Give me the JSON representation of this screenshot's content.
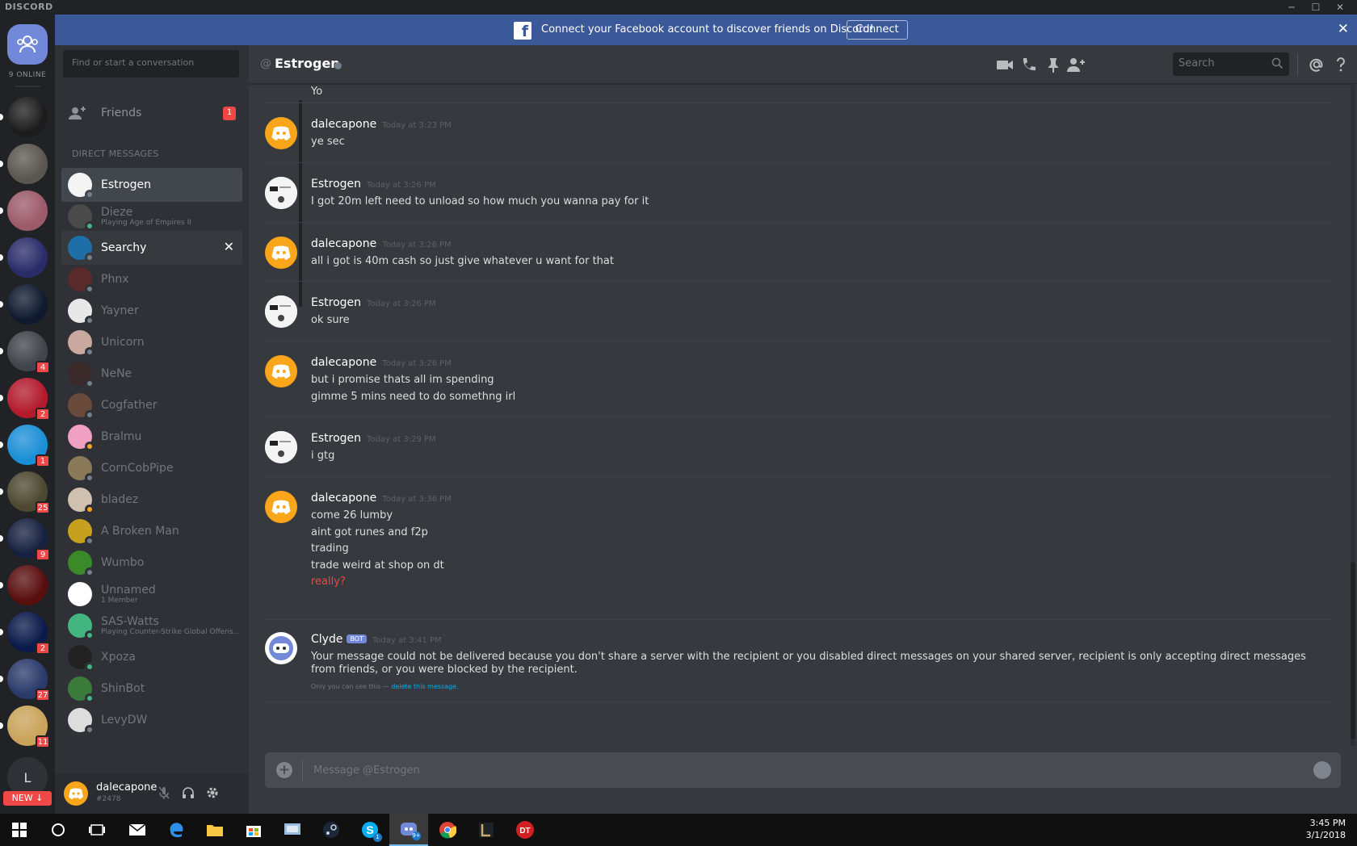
{
  "window": {
    "brand": "DISCORD",
    "controls": [
      "─",
      "☐",
      "✕"
    ]
  },
  "guilds": {
    "online_label": "9 ONLINE",
    "items": [
      {
        "color": "#1c1c1c",
        "badge": "",
        "pill": true
      },
      {
        "color": "#5a5650",
        "badge": "",
        "pill": true
      },
      {
        "color": "#9c5a6a",
        "badge": "",
        "pill": true
      },
      {
        "color": "#2a2c6a",
        "badge": "",
        "pill": true
      },
      {
        "color": "#0f1a2e",
        "badge": "",
        "pill": true
      },
      {
        "color": "#40444b",
        "badge": "4",
        "pill": true
      },
      {
        "color": "#b31b2d",
        "badge": "2",
        "pill": true
      },
      {
        "color": "#1b8fd6",
        "badge": "1",
        "pill": true
      },
      {
        "color": "#4d4830",
        "badge": "25",
        "pill": true
      },
      {
        "color": "#162040",
        "badge": "9",
        "pill": true
      },
      {
        "color": "#5a0f0f",
        "badge": "",
        "pill": true
      },
      {
        "color": "#0a1a4a",
        "badge": "2",
        "pill": true
      },
      {
        "color": "#2a3a6a",
        "badge": "27",
        "pill": true
      },
      {
        "color": "#c9a35a",
        "badge": "11",
        "pill": true
      }
    ],
    "letter_guild": "L",
    "new_label": "NEW ↓"
  },
  "sidebar": {
    "search_placeholder": "Find or start a conversation",
    "friends_label": "Friends",
    "friends_badge": "1",
    "dm_header": "DIRECT MESSAGES",
    "dms": [
      {
        "name": "Estrogen",
        "sub": "",
        "status": "#747f8d",
        "avatar": "#f4f4f4"
      },
      {
        "name": "Dieze",
        "sub": "Playing Age of Empires II",
        "status": "#43b581",
        "avatar": "#4a4a4a"
      },
      {
        "name": "Searchy",
        "sub": "",
        "status": "#747f8d",
        "avatar": "#1e6fa8"
      },
      {
        "name": "Phnx",
        "sub": "",
        "status": "#747f8d",
        "avatar": "#5a2a2a"
      },
      {
        "name": "Yayner",
        "sub": "",
        "status": "#747f8d",
        "avatar": "#e8e8e8"
      },
      {
        "name": "Unicorn",
        "sub": "",
        "status": "#747f8d",
        "avatar": "#c9a8a0"
      },
      {
        "name": "NeNe",
        "sub": "",
        "status": "#747f8d",
        "avatar": "#3a2a2a"
      },
      {
        "name": "Cogfather",
        "sub": "",
        "status": "#747f8d",
        "avatar": "#6a4a3a"
      },
      {
        "name": "Bralmu",
        "sub": "",
        "status": "#faa61a",
        "avatar": "#f0a0c0"
      },
      {
        "name": "CornCobPipe",
        "sub": "",
        "status": "#747f8d",
        "avatar": "#8a7a5a"
      },
      {
        "name": "bladez",
        "sub": "",
        "status": "#faa61a",
        "avatar": "#d0c0b0"
      },
      {
        "name": "A Broken Man",
        "sub": "",
        "status": "#747f8d",
        "avatar": "#c8a020"
      },
      {
        "name": "Wumbo",
        "sub": "",
        "status": "#747f8d",
        "avatar": "#3a8a2a"
      },
      {
        "name": "Unnamed",
        "sub": "1 Member",
        "status": "",
        "avatar": "#ffffff"
      },
      {
        "name": "SAS-Watts",
        "sub": "Playing Counter-Strike Global Offens...",
        "status": "#43b581",
        "avatar": "#43b581"
      },
      {
        "name": "Xpoza",
        "sub": "",
        "status": "#43b581",
        "avatar": "#222222"
      },
      {
        "name": "ShinBot",
        "sub": "",
        "status": "#43b581",
        "avatar": "#3a7a3a"
      },
      {
        "name": "LevyDW",
        "sub": "",
        "status": "#747f8d",
        "avatar": "#dddddd"
      }
    ]
  },
  "user": {
    "name": "dalecapone",
    "tag": "#2478"
  },
  "banner": {
    "text": "Connect your Facebook account to discover friends on Discord!",
    "button": "Connect"
  },
  "header": {
    "at": "@",
    "name": "Estrogen",
    "search_placeholder": "Search"
  },
  "messages": [
    {
      "author": "",
      "time": "",
      "avatar": "none",
      "lines": [
        "Yo"
      ],
      "red": []
    },
    {
      "author": "dalecapone",
      "time": "Today at 3:23 PM",
      "avatar": "dc",
      "lines": [
        "ye sec"
      ],
      "red": []
    },
    {
      "author": "Estrogen",
      "time": "Today at 3:26 PM",
      "avatar": "es",
      "lines": [
        "I got 20m left need to unload so how much you wanna pay for it"
      ],
      "red": []
    },
    {
      "author": "dalecapone",
      "time": "Today at 3:26 PM",
      "avatar": "dc",
      "lines": [
        "all i got is 40m cash so just give whatever u want for that"
      ],
      "red": []
    },
    {
      "author": "Estrogen",
      "time": "Today at 3:26 PM",
      "avatar": "es",
      "lines": [
        "ok sure"
      ],
      "red": []
    },
    {
      "author": "dalecapone",
      "time": "Today at 3:26 PM",
      "avatar": "dc",
      "lines": [
        "but i promise thats all im spending",
        "gimme 5 mins need to do somethng irl"
      ],
      "red": []
    },
    {
      "author": "Estrogen",
      "time": "Today at 3:29 PM",
      "avatar": "es",
      "lines": [
        "i gtg"
      ],
      "red": []
    },
    {
      "author": "dalecapone",
      "time": "Today at 3:36 PM",
      "avatar": "dc",
      "lines": [
        "come 26 lumby",
        "aint got runes and f2p",
        "trading",
        "trade weird at shop on dt",
        "really?"
      ],
      "red": [
        4
      ]
    }
  ],
  "clyde": {
    "author": "Clyde",
    "bot_tag": "BOT",
    "time": "Today at 3:41 PM",
    "text": "Your message could not be delivered because you don't share a server with the recipient or you disabled direct messages on your shared server, recipient is only accepting direct messages from friends, or you were blocked by the recipient.",
    "note_prefix": "Only you can see this — ",
    "note_link": "delete this message."
  },
  "composer": {
    "placeholder": "Message @Estrogen"
  },
  "taskbar": {
    "time": "3:45 PM",
    "date": "3/1/2018",
    "skype_badge": "1",
    "discord_badge": "9+"
  }
}
